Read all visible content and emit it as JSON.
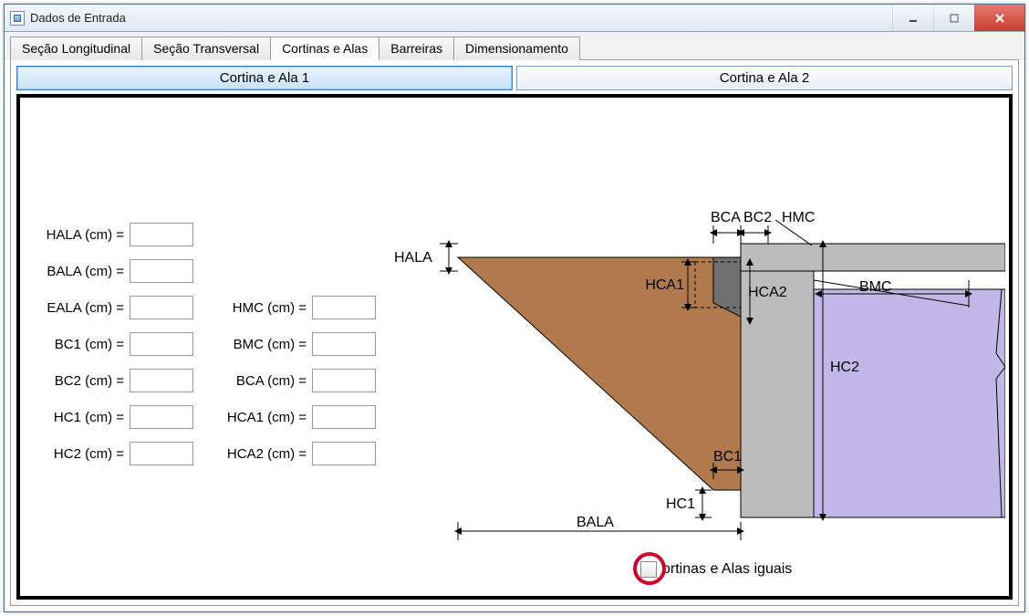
{
  "window": {
    "title": "Dados de Entrada"
  },
  "tabs": [
    {
      "label": "Seção Longitudinal"
    },
    {
      "label": "Seção Transversal"
    },
    {
      "label": "Cortinas e Alas"
    },
    {
      "label": "Barreiras"
    },
    {
      "label": "Dimensionamento"
    }
  ],
  "active_tab": "Cortinas e Alas",
  "subtabs": [
    {
      "label": "Cortina e Ala 1"
    },
    {
      "label": "Cortina e Ala 2"
    }
  ],
  "active_subtab": "Cortina e Ala 1",
  "fields_col1": [
    {
      "label": "HALA (cm) =",
      "value": ""
    },
    {
      "label": "BALA (cm) =",
      "value": ""
    },
    {
      "label": "EALA (cm) =",
      "value": ""
    },
    {
      "label": "BC1 (cm) =",
      "value": ""
    },
    {
      "label": "BC2 (cm) =",
      "value": ""
    },
    {
      "label": "HC1 (cm) =",
      "value": ""
    },
    {
      "label": "HC2 (cm) =",
      "value": ""
    }
  ],
  "fields_col2": [
    {
      "label": "HMC (cm) =",
      "value": ""
    },
    {
      "label": "BMC (cm) =",
      "value": ""
    },
    {
      "label": "BCA (cm) =",
      "value": ""
    },
    {
      "label": "HCA1 (cm) =",
      "value": ""
    },
    {
      "label": "HCA2 (cm) =",
      "value": ""
    }
  ],
  "diagram_labels": {
    "HALA": "HALA",
    "BALA": "BALA",
    "HC1": "HC1",
    "BC1": "BC1",
    "HC2": "HC2",
    "BCA": "BCA",
    "BC2": "BC2",
    "HMC": "HMC",
    "BMC": "BMC",
    "HCA1": "HCA1",
    "HCA2": "HCA2"
  },
  "checkbox_label": "ortinas e Alas iguais"
}
